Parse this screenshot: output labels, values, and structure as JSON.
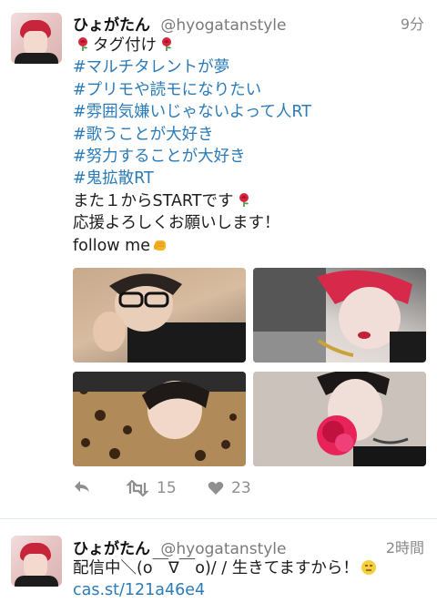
{
  "tweets": [
    {
      "display_name": "ひょがたん",
      "screen_name": "@hyogatanstyle",
      "time": "9分",
      "lines": [
        {
          "type": "text",
          "before": "",
          "text": "タグ付け",
          "after": "",
          "emoji": "rose-emoji"
        },
        {
          "type": "hashtag",
          "text": "#マルチタレントが夢"
        },
        {
          "type": "hashtag",
          "text": "#プリモや読モになりたい"
        },
        {
          "type": "hashtag",
          "text": "#雰囲気嫌いじゃないよって人RT"
        },
        {
          "type": "hashtag",
          "text": "#歌うことが大好き"
        },
        {
          "type": "hashtag",
          "text": "#努力することが大好き"
        },
        {
          "type": "hashtag",
          "text": "#鬼拡散RT"
        },
        {
          "type": "text",
          "text": "また１からSTARTです",
          "emoji": "rose-emoji"
        },
        {
          "type": "text",
          "text": "応援よろしくお願いします！"
        },
        {
          "type": "text",
          "text": "follow me",
          "emoji": "fist-emoji"
        }
      ],
      "media": [
        "photo-glasses-selfie",
        "photo-red-hair-selfie",
        "photo-leopard-shirt-selfie",
        "photo-rose-selfie"
      ],
      "actions": {
        "reply_icon": "reply-icon",
        "retweet_icon": "retweet-icon",
        "retweet_count": "15",
        "like_icon": "heart-icon",
        "like_count": "23"
      }
    },
    {
      "display_name": "ひょがたん",
      "screen_name": "@hyogatanstyle",
      "time": "2時間",
      "text": "配信中＼(o￣∇￣o)/ / 生きてますから！",
      "emoji": "expressionless-face-emoji",
      "link": "cas.st/121a46e4"
    }
  ],
  "colors": {
    "hashtag": "#2b7bb9",
    "secondary_text": "#7a7a7a",
    "divider": "#e1e8ed"
  }
}
